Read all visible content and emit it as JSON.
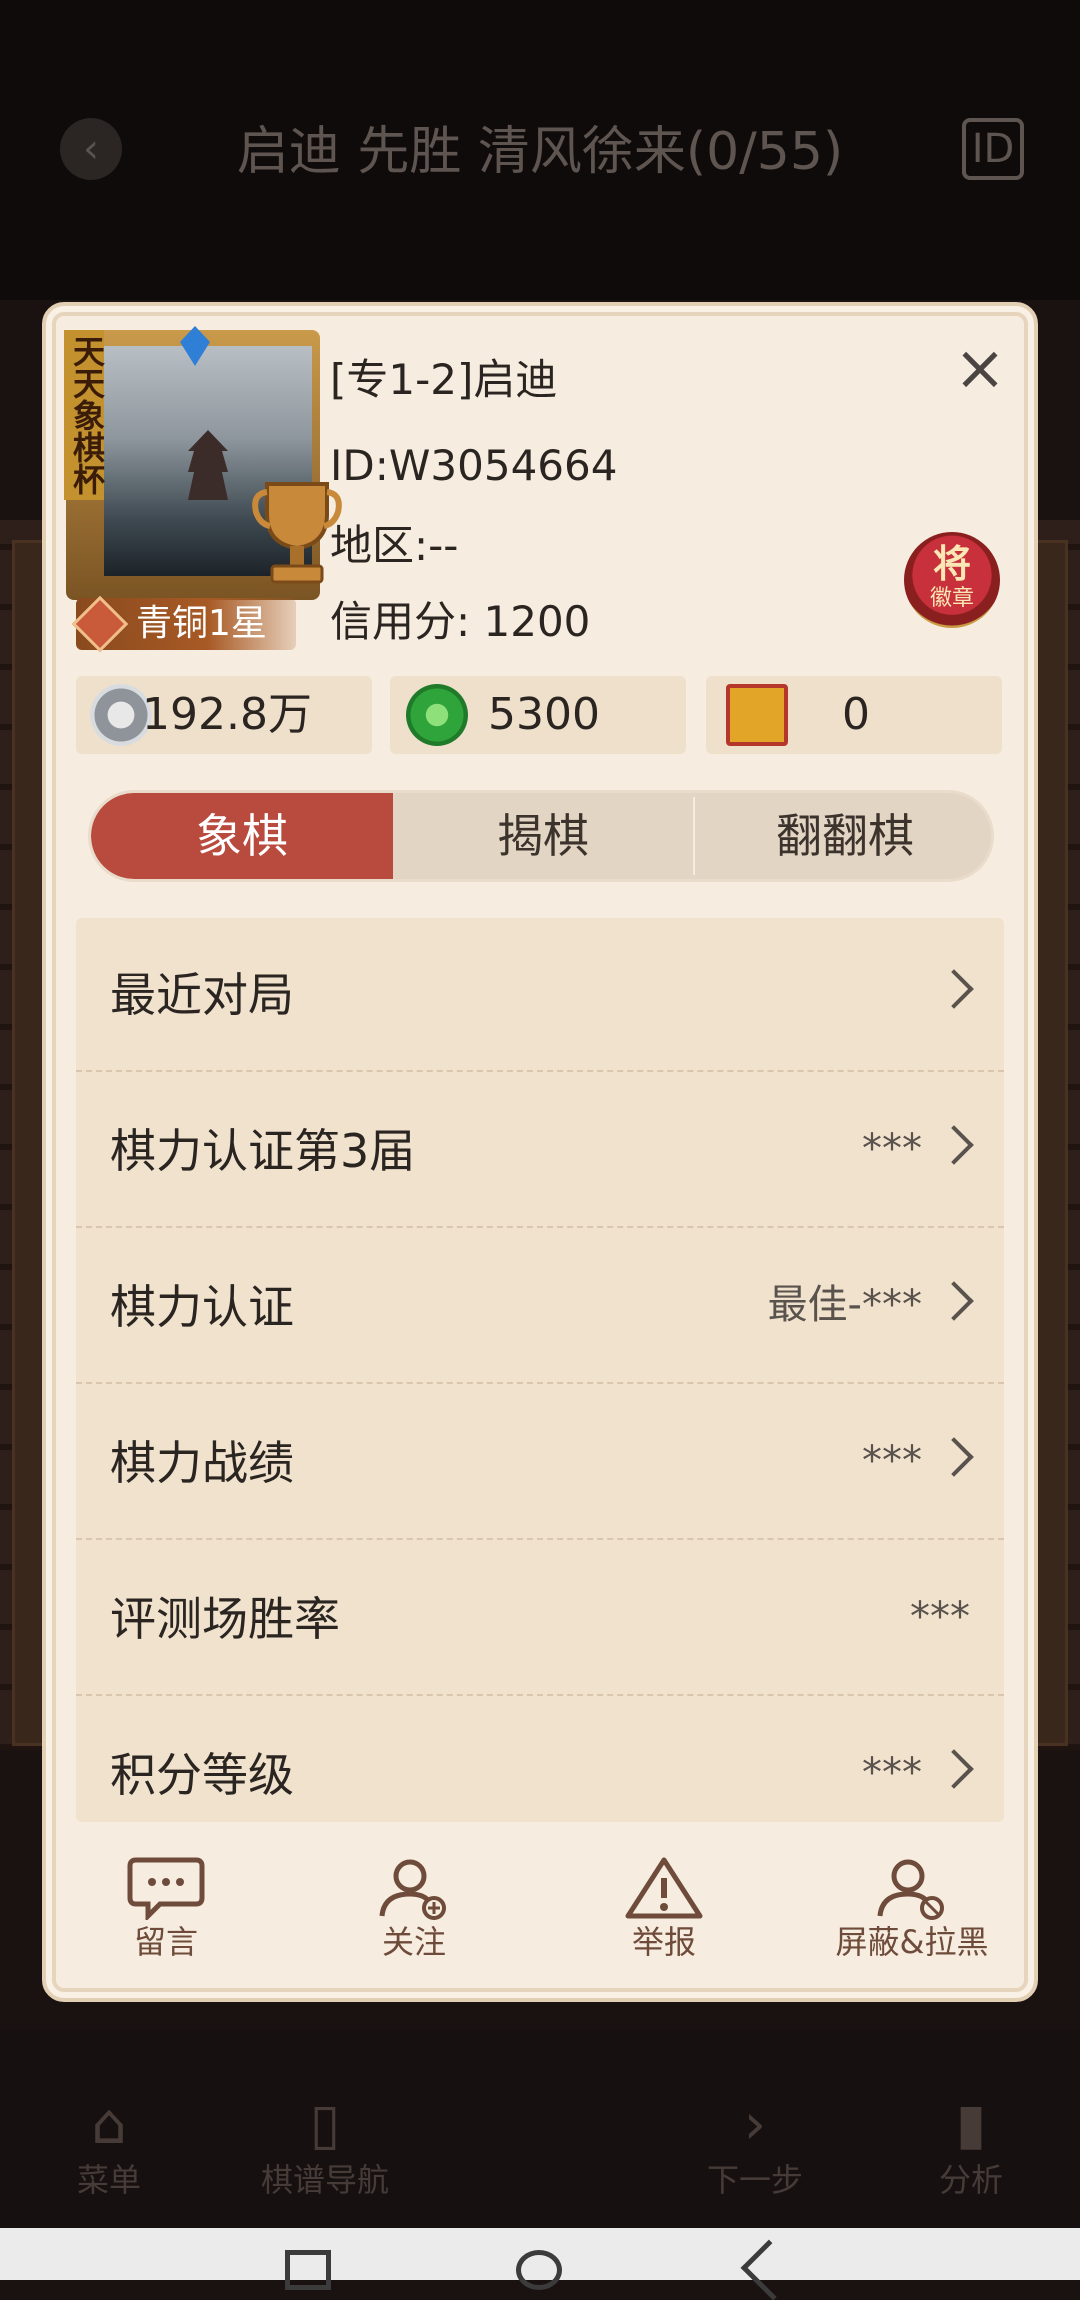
{
  "background": {
    "title": "启迪 先胜 清风徐来(0/55)",
    "id_button": "ID",
    "nav": [
      {
        "label": "菜单",
        "icon": "menu-icon"
      },
      {
        "label": "棋谱导航",
        "icon": "book-icon"
      },
      {
        "label": "下一步",
        "icon": "next-icon"
      },
      {
        "label": "分析",
        "icon": "chart-icon"
      }
    ]
  },
  "profile": {
    "avatar_banner": "天天象棋杯",
    "rank": "青铜1星",
    "name": "[专1-2]启迪",
    "id": "ID:W3054664",
    "region": "地区:--",
    "credit": "信用分: 1200",
    "medal_big": "将",
    "medal_small": "徽章"
  },
  "currencies": [
    {
      "icon": "silver-coin-icon",
      "value": "192.8万"
    },
    {
      "icon": "jade-icon",
      "value": "5300"
    },
    {
      "icon": "board-ticket-icon",
      "value": "0"
    }
  ],
  "tabs": [
    {
      "label": "象棋",
      "active": true
    },
    {
      "label": "揭棋",
      "active": false
    },
    {
      "label": "翻翻棋",
      "active": false
    }
  ],
  "rows": [
    {
      "label": "最近对局",
      "value": "",
      "chevron": true
    },
    {
      "label": "棋力认证第3届",
      "value": "***",
      "chevron": true
    },
    {
      "label": "棋力认证",
      "value": "最佳-***",
      "chevron": true
    },
    {
      "label": "棋力战绩",
      "value": "***",
      "chevron": true
    },
    {
      "label": "评测场胜率",
      "value": "***",
      "chevron": false
    },
    {
      "label": "积分等级",
      "value": "***",
      "chevron": true
    }
  ],
  "actions": [
    {
      "label": "留言",
      "icon": "message-icon"
    },
    {
      "label": "关注",
      "icon": "follow-icon"
    },
    {
      "label": "举报",
      "icon": "report-icon"
    },
    {
      "label": "屏蔽&拉黑",
      "icon": "block-icon"
    }
  ],
  "colors": {
    "accent_tab": "#b84a3e",
    "dialog_bg": "#f6ecdf",
    "action_text": "#6e4b3a"
  }
}
